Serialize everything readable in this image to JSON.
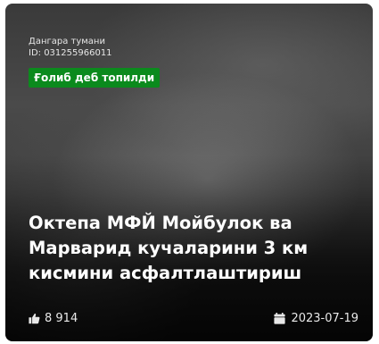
{
  "card": {
    "district": "Дангара тумани",
    "id_label": "ID: 031255966011",
    "status_badge": "Ғолиб деб топилди",
    "title": "Октепа МФЙ Мойбулок ва Марварид кучаларини 3 км кисмини асфалтлаштириш",
    "likes_count": "8 914",
    "date": "2023-07-19",
    "icons": {
      "likes": "thumbs-up-icon",
      "date": "calendar-icon"
    },
    "colors": {
      "badge_background": "#0b8a1d",
      "text": "#ffffff"
    }
  }
}
